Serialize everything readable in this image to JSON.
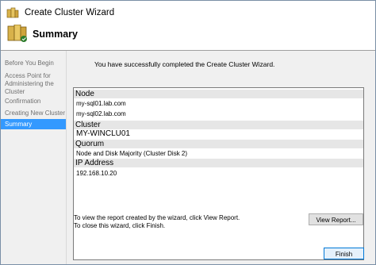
{
  "window": {
    "title": "Create Cluster Wizard"
  },
  "header": {
    "title": "Summary"
  },
  "steps": [
    {
      "label": "Before You Begin"
    },
    {
      "label": "Access Point for Administering the Cluster"
    },
    {
      "label": "Confirmation"
    },
    {
      "label": "Creating New Cluster"
    },
    {
      "label": "Summary"
    }
  ],
  "main": {
    "intro": "You have successfully completed the Create Cluster Wizard.",
    "report": {
      "node_heading": "Node",
      "node_1": "my-sql01.lab.com",
      "node_2": "my-sql02.lab.com",
      "cluster_heading": "Cluster",
      "cluster_name": "MY-WINCLU01",
      "quorum_heading": "Quorum",
      "quorum_value": "Node and Disk Majority (Cluster Disk 2)",
      "ip_heading": "IP Address",
      "ip_value": "192.168.10.20"
    },
    "hint_1": "To view the report created by the wizard, click View Report.",
    "hint_2": "To close this wizard, click Finish.",
    "view_report_label": "View Report...",
    "finish_label": "Finish"
  },
  "colors": {
    "active_step": "#3399ff",
    "section_header": "#e6e6e6",
    "body_bg": "#f0f0f0"
  }
}
